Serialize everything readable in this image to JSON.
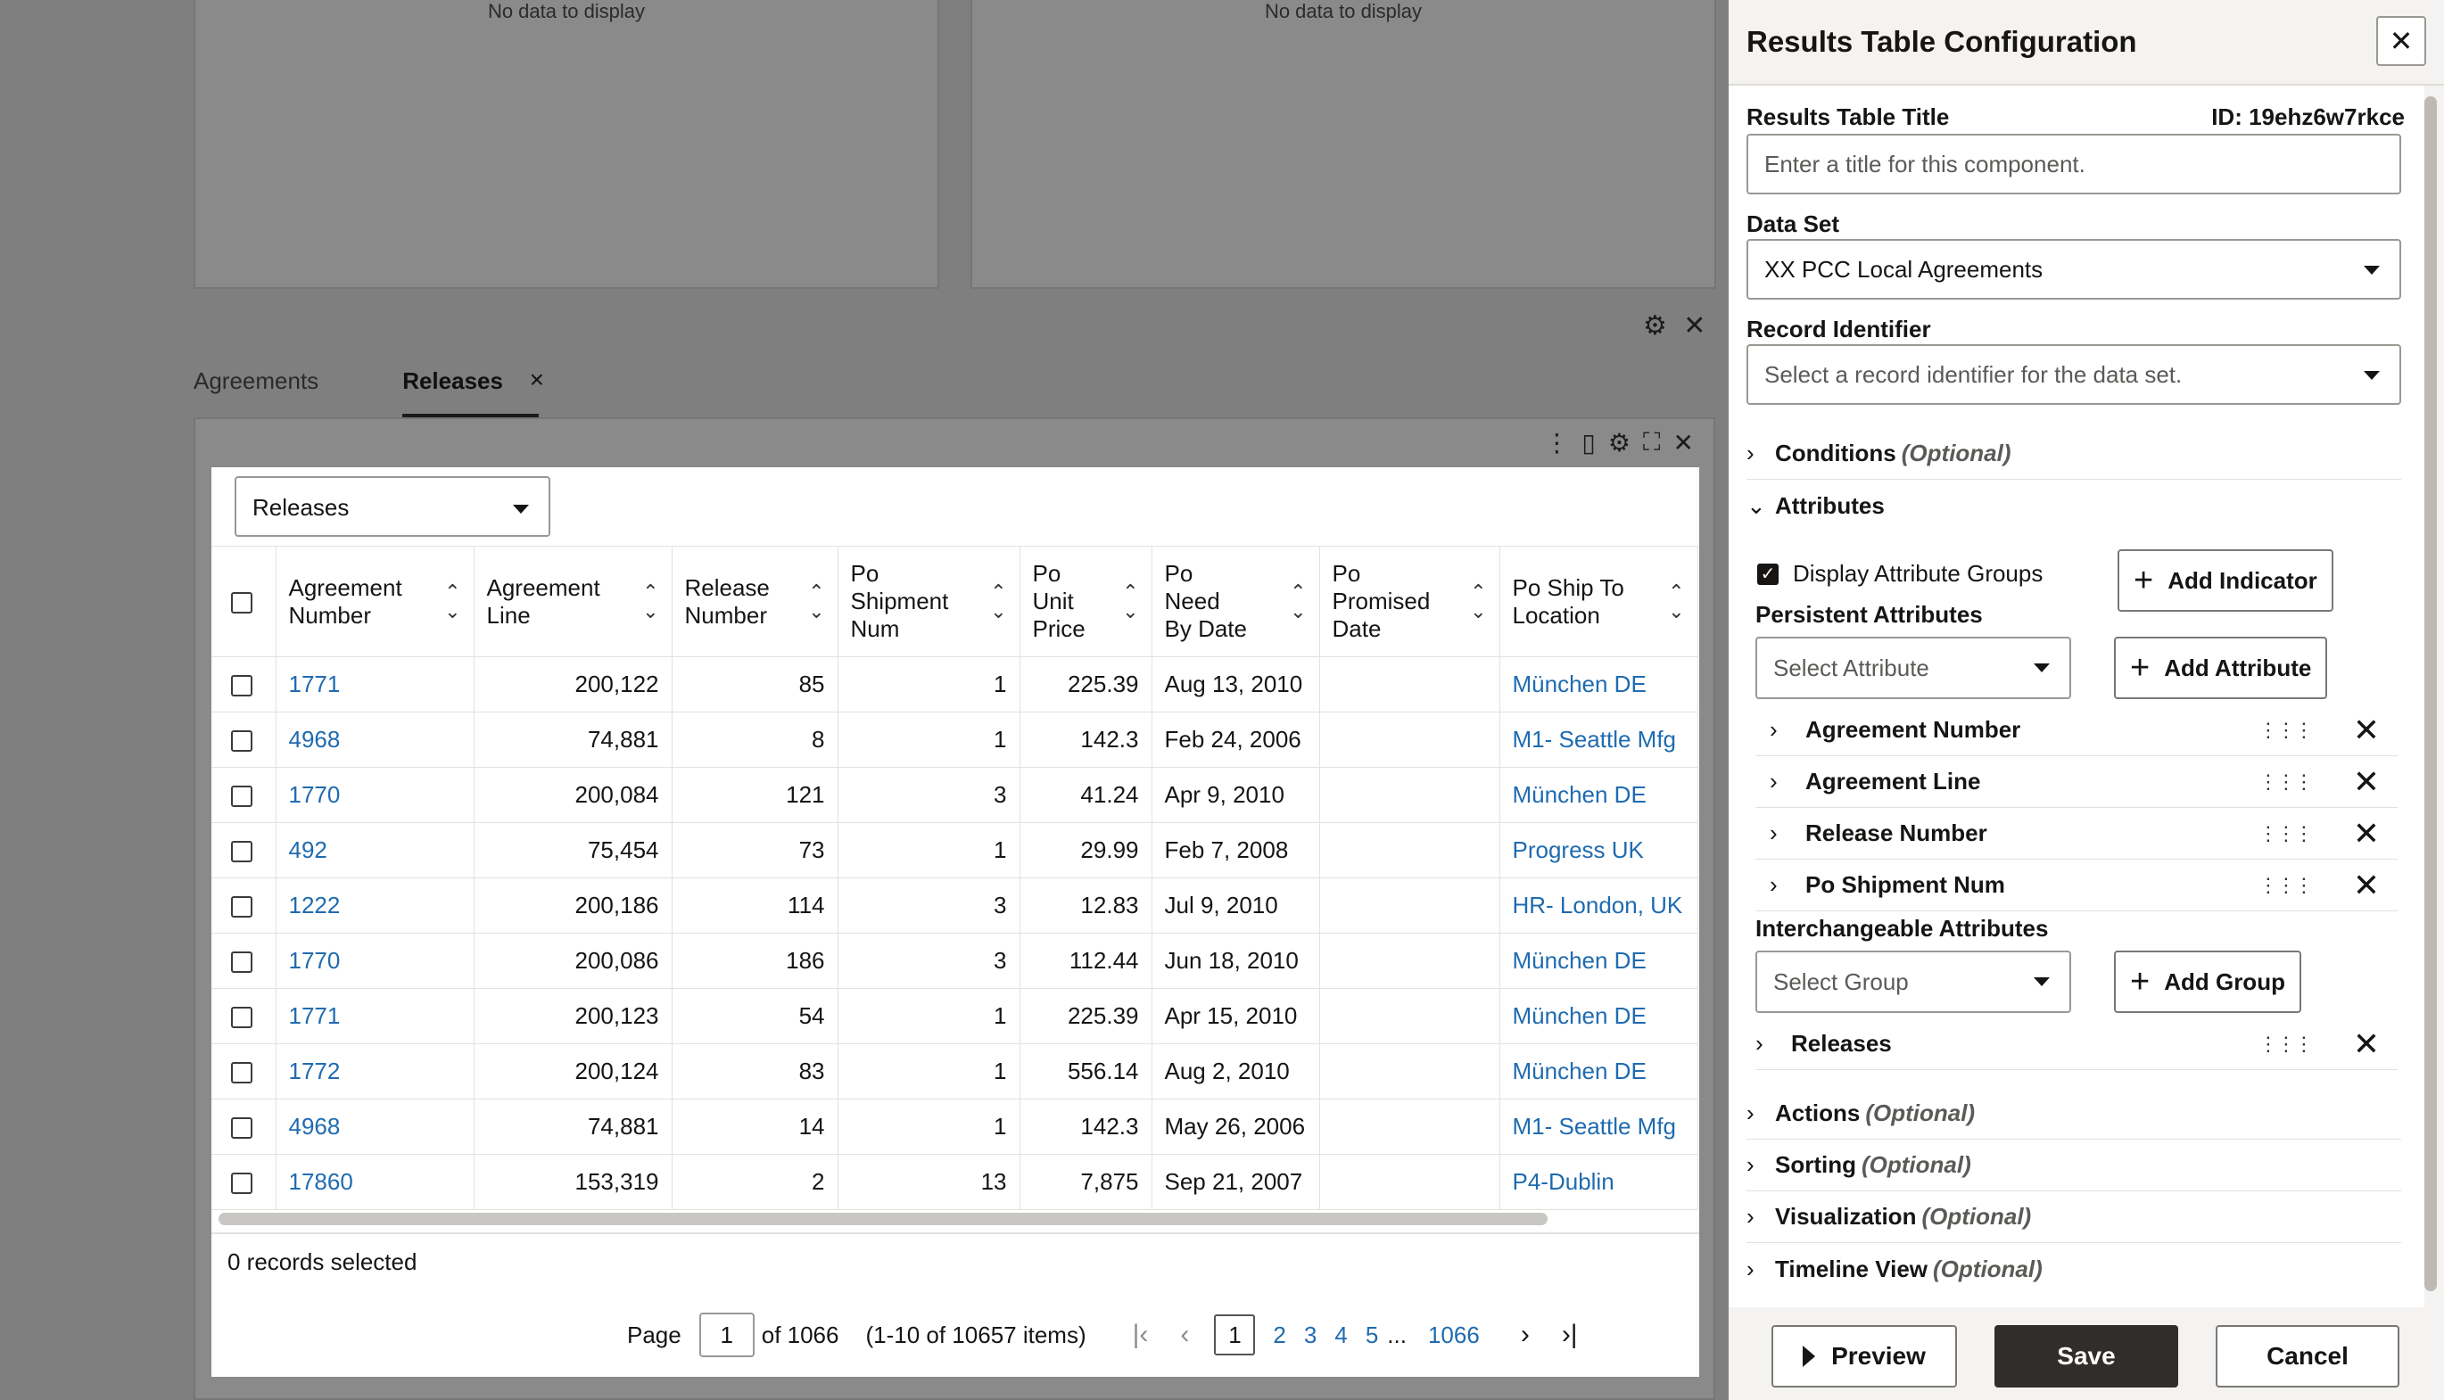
{
  "background": {
    "nodata_left": "No data to display",
    "nodata_right": "No data to display",
    "tabs": [
      {
        "label": "Agreements"
      },
      {
        "label": "Releases",
        "close": "×"
      }
    ]
  },
  "dataset_select": {
    "value": "Releases"
  },
  "table": {
    "columns": [
      "Agreement Number",
      "Agreement Line",
      "Release Number",
      "Po Shipment Num",
      "Po Unit Price",
      "Po Need By Date",
      "Po Promised Date",
      "Po Ship To Location"
    ],
    "column_lines": [
      [
        "Agreement",
        "Number"
      ],
      [
        "Agreement",
        "Line"
      ],
      [
        "Release",
        "Number"
      ],
      [
        "Po",
        "Shipment",
        "Num"
      ],
      [
        "Po",
        "Unit",
        "Price"
      ],
      [
        "Po",
        "Need",
        "By Date"
      ],
      [
        "Po",
        "Promised",
        "Date"
      ],
      [
        "Po Ship To",
        "Location"
      ]
    ],
    "rows": [
      [
        "1771",
        "200,122",
        "85",
        "1",
        "225.39",
        "Aug 13, 2010",
        "",
        "München DE"
      ],
      [
        "4968",
        "74,881",
        "8",
        "1",
        "142.3",
        "Feb 24, 2006",
        "",
        "M1- Seattle Mfg"
      ],
      [
        "1770",
        "200,084",
        "121",
        "3",
        "41.24",
        "Apr 9, 2010",
        "",
        "München DE"
      ],
      [
        "492",
        "75,454",
        "73",
        "1",
        "29.99",
        "Feb 7, 2008",
        "",
        "Progress UK"
      ],
      [
        "1222",
        "200,186",
        "114",
        "3",
        "12.83",
        "Jul 9, 2010",
        "",
        "HR- London, UK"
      ],
      [
        "1770",
        "200,086",
        "186",
        "3",
        "112.44",
        "Jun 18, 2010",
        "",
        "München DE"
      ],
      [
        "1771",
        "200,123",
        "54",
        "1",
        "225.39",
        "Apr 15, 2010",
        "",
        "München DE"
      ],
      [
        "1772",
        "200,124",
        "83",
        "1",
        "556.14",
        "Aug 2, 2010",
        "",
        "München DE"
      ],
      [
        "4968",
        "74,881",
        "14",
        "1",
        "142.3",
        "May 26, 2006",
        "",
        "M1- Seattle Mfg"
      ],
      [
        "17860",
        "153,319",
        "2",
        "13",
        "7,875",
        "Sep 21, 2007",
        "",
        "P4-Dublin"
      ]
    ]
  },
  "footer": {
    "records_selected": "0 records selected",
    "page_label": "Page",
    "page_value": "1",
    "of_pages": "of 1066",
    "items_range": "(1-10 of 10657 items)",
    "pages": [
      "1",
      "2",
      "3",
      "4",
      "5"
    ],
    "ellipsis": "...",
    "last_page": "1066"
  },
  "drawer": {
    "title": "Results Table Configuration",
    "title_label": "Results Table Title",
    "id_text": "ID: 19ehz6w7rkce",
    "title_placeholder": "Enter a title for this component.",
    "dataset_label": "Data Set",
    "dataset_value": "XX PCC Local Agreements",
    "record_id_label": "Record Identifier",
    "record_id_placeholder": "Select a record identifier for the data set.",
    "conditions": "Conditions",
    "optional": "(Optional)",
    "attributes": "Attributes",
    "display_groups": "Display Attribute Groups",
    "add_indicator": "Add Indicator",
    "persistent_label": "Persistent Attributes",
    "select_attribute": "Select Attribute",
    "add_attribute": "Add Attribute",
    "persistent_items": [
      "Agreement Number",
      "Agreement Line",
      "Release Number",
      "Po Shipment Num"
    ],
    "interchangeable_label": "Interchangeable Attributes",
    "select_group": "Select Group",
    "add_group": "Add Group",
    "group_items": [
      "Releases"
    ],
    "actions": "Actions",
    "sorting": "Sorting",
    "visualization": "Visualization",
    "timeline": "Timeline View",
    "preview": "Preview",
    "save": "Save",
    "cancel": "Cancel"
  }
}
